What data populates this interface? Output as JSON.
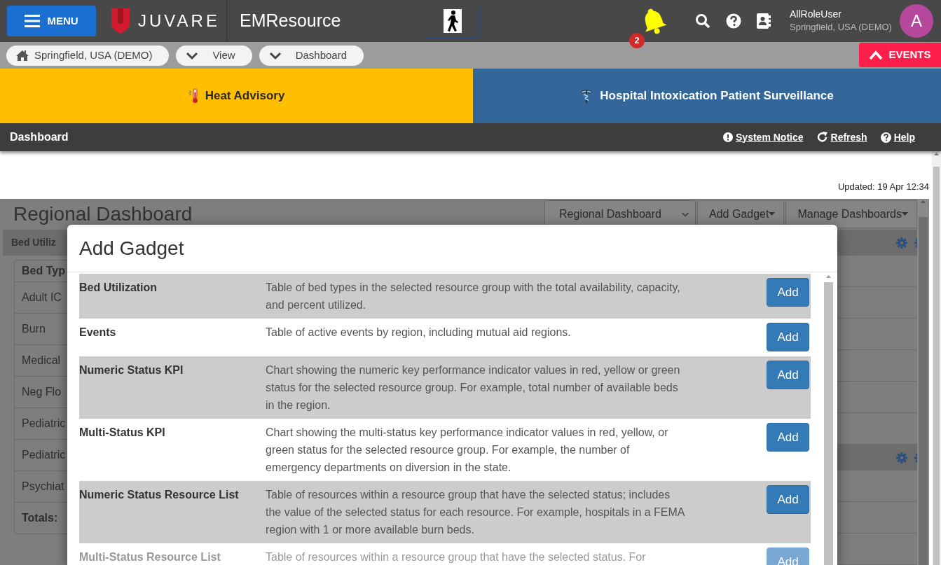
{
  "header": {
    "menu_button": "MENU",
    "logo": "JUVARE",
    "app_name": "EMResource",
    "notification_count": "2",
    "user": {
      "name": "AllRoleUser",
      "location": "Springfield, USA (DEMO)",
      "avatar_initial": "A"
    }
  },
  "breadcrumbs": [
    {
      "label": "Springfield, USA (DEMO)",
      "kind": "home"
    },
    {
      "label": "View",
      "kind": "dropdown"
    },
    {
      "label": "Dashboard",
      "kind": "dropdown"
    }
  ],
  "events_button": "EVENTS",
  "event_banners": [
    {
      "title": "Heat Advisory",
      "kind": "heat",
      "color": "#ffbf00"
    },
    {
      "title": "Hospital Intoxication Patient Surveillance",
      "kind": "medical",
      "color": "#336699"
    }
  ],
  "page_bar": {
    "title": "Dashboard",
    "actions": [
      {
        "label": "System Notice",
        "kind": "info"
      },
      {
        "label": "Refresh",
        "kind": "refresh"
      },
      {
        "label": "Help",
        "kind": "help"
      }
    ]
  },
  "updated": "Updated: 19 Apr 12:34",
  "dashboard": {
    "title": "Regional Dashboard",
    "selector": "Regional Dashboard",
    "buttons": [
      "Add Gadget",
      "Manage Dashboards"
    ],
    "panel_title": "Bed Utiliz",
    "table_header": "Bed Typ",
    "rows": [
      "Adult IC",
      "Burn",
      "Medical",
      "Neg Flo",
      "Pediatric",
      "Pediatric",
      "Psychiat",
      "Totals:"
    ]
  },
  "modal": {
    "title": "Add Gadget",
    "gadgets": [
      {
        "name": "Bed Utilization",
        "description": "Table of bed types in the selected resource group with the total availability, capacity, and percent utilized.",
        "button": "Add"
      },
      {
        "name": "Events",
        "description": "Table of active events by region, including mutual aid regions.",
        "button": "Add"
      },
      {
        "name": "Numeric Status KPI",
        "description": "Chart showing the numeric key performance indicator values in red, yellow or green status for the selected resource group. For example, total number of available beds in the region.",
        "button": "Add"
      },
      {
        "name": "Multi-Status KPI",
        "description": "Chart showing the multi-status key performance indicator values in red, yellow, or green status for the selected resource group. For example, the number of emergency departments on diversion in the state.",
        "button": "Add"
      },
      {
        "name": "Numeric Status Resource List",
        "description": "Table of resources within a resource group that have the selected status; includes the value of the selected status for each resource. For example, hospitals in a FEMA region with 1 or more available burn beds.",
        "button": "Add"
      },
      {
        "name": "Multi-Status Resource List",
        "description": "Table of resources within a resource group that have the selected status. For",
        "button": "Add"
      }
    ]
  }
}
